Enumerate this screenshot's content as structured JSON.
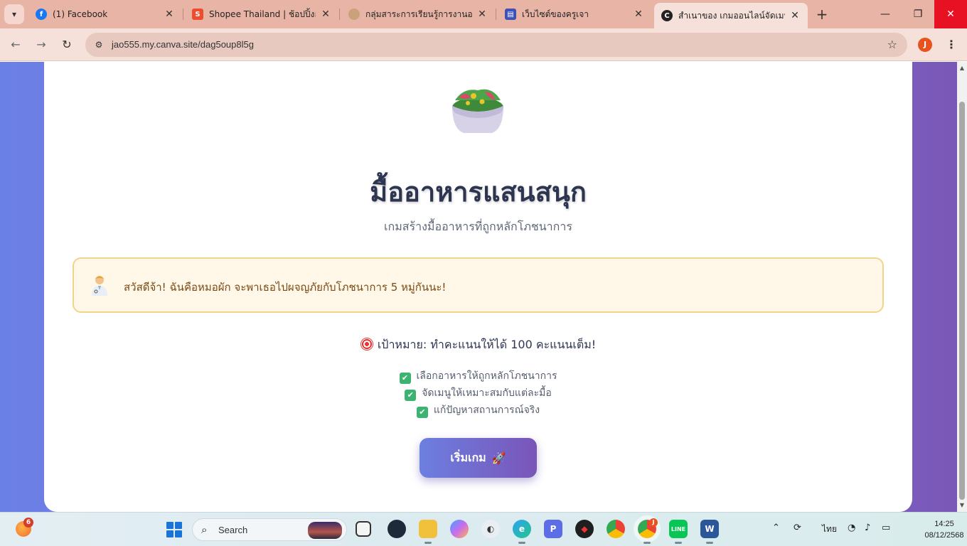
{
  "browser": {
    "tabs": [
      {
        "title": "(1) Facebook",
        "favicon": "facebook-icon",
        "color": "#1877f2"
      },
      {
        "title": "Shopee Thailand | ช้อปปิ้งออนไ",
        "favicon": "shopee-icon",
        "color": "#ee4d2d"
      },
      {
        "title": "กลุ่มสาระการเรียนรู้การงานอาชีพ",
        "favicon": "school-icon",
        "color": "#c9a27a"
      },
      {
        "title": "เว็บไซต์ของครูเจา",
        "favicon": "sites-icon",
        "color": "#3f51b5"
      },
      {
        "title": "สำเนาของ เกมออนไลน์จัดเมนูอาห",
        "favicon": "canva-icon",
        "color": "#222222",
        "active": true
      }
    ],
    "url": "jao555.my.canva.site/dag5oup8l5g",
    "profile_initial": "J"
  },
  "page": {
    "title": "มื้ออาหารแสนสนุก",
    "subtitle": "เกมสร้างมื้ออาหารที่ถูกหลักโภชนาการ",
    "speech": "สวัสดีจ้า! ฉันคือหมอผัก จะพาเธอไปผจญภัยกับโภชนาการ 5 หมู่กันนะ!",
    "goal": "เป้าหมาย: ทำคะแนนให้ได้ 100 คะแนนเต็ม!",
    "checklist": [
      "เลือกอาหารให้ถูกหลักโภชนาการ",
      "จัดเมนูให้เหมาะสมกับแต่ละมื้อ",
      "แก้ปัญหาสถานการณ์จริง"
    ],
    "start_button": "เริ่มเกม",
    "colors": {
      "title": "#2d3550",
      "speech_bg": "#fff8e8",
      "speech_border": "#f2d38a",
      "button_from": "#6c7fe0",
      "button_to": "#7a55b8",
      "check": "#3cb371"
    }
  },
  "taskbar": {
    "widget_badge": "6",
    "search_label": "Search",
    "chrome_badge": "J",
    "language": "ไทย",
    "time": "14:25",
    "date": "08/12/2568"
  }
}
